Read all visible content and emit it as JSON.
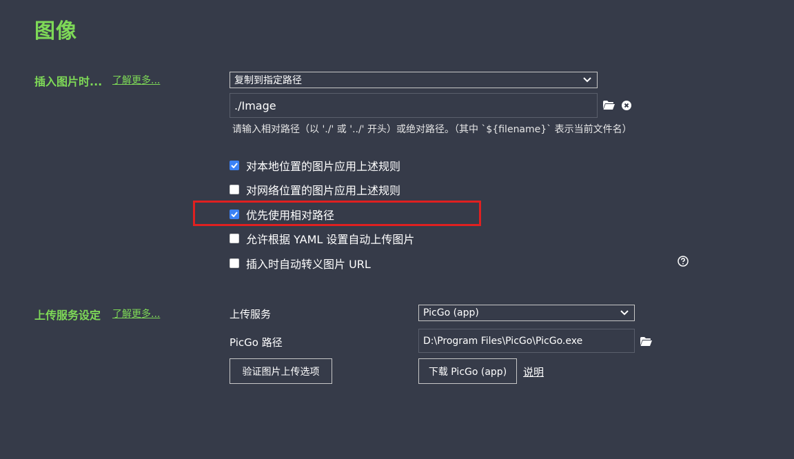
{
  "page": {
    "title": "图像"
  },
  "insert_section": {
    "label": "插入图片时...",
    "learn_more": "了解更多...",
    "action_select": {
      "value": "复制到指定路径"
    },
    "path_input": {
      "value": "./Image"
    },
    "path_hint": "请输入相对路径（以 './' 或 '../' 开头）或绝对路径。（其中 `${filename}` 表示当前文件名）",
    "checkboxes": [
      {
        "label": "对本地位置的图片应用上述规则",
        "checked": true
      },
      {
        "label": "对网络位置的图片应用上述规则",
        "checked": false
      },
      {
        "label": "优先使用相对路径",
        "checked": true
      },
      {
        "label": "允许根据 YAML 设置自动上传图片",
        "checked": false
      },
      {
        "label": "插入时自动转义图片 URL",
        "checked": false
      }
    ]
  },
  "upload_section": {
    "label": "上传服务设定",
    "learn_more": "了解更多...",
    "service_label": "上传服务",
    "service_select": {
      "value": "PicGo (app)"
    },
    "picgo_path_label": "PicGo 路径",
    "picgo_path_input": {
      "value": "D:\\Program Files\\PicGo\\PicGo.exe"
    },
    "verify_button": "验证图片上传选项",
    "download_button": "下载 PicGo (app)",
    "explain_link": "说明"
  },
  "colors": {
    "background": "#363b49",
    "accent_green": "#7ed957",
    "checkbox_blue": "#3b82f6",
    "highlight_red": "#e02020"
  },
  "icons": [
    "folder-icon",
    "clear-icon",
    "chevron-down-icon",
    "help-icon",
    "check-icon"
  ]
}
